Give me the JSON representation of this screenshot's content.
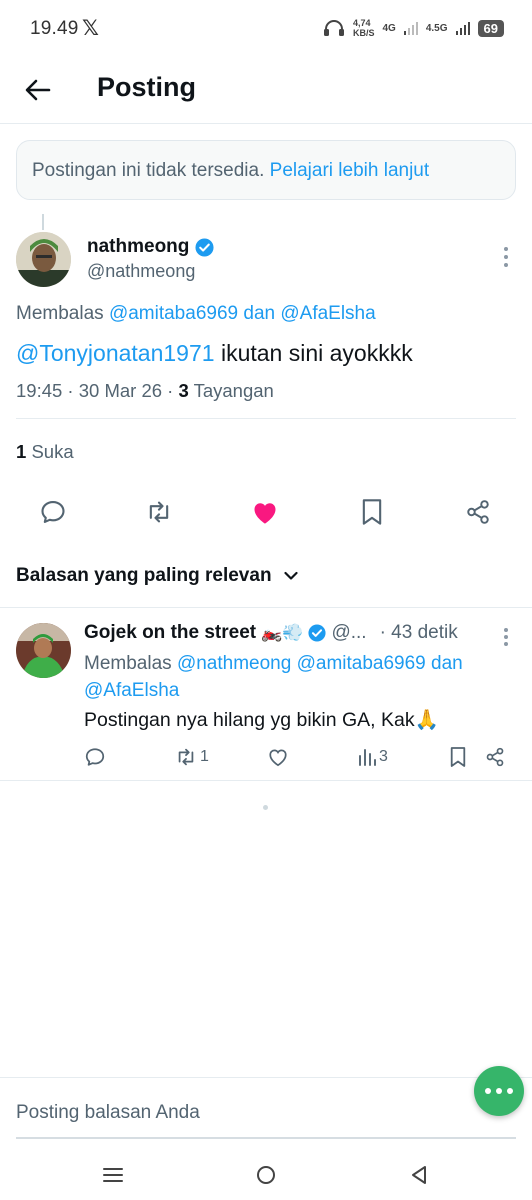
{
  "status": {
    "time": "19.49",
    "x_logo": "𝕏",
    "net_speed": "4,74",
    "net_unit": "KB/S",
    "sig1": "4G",
    "sig2": "4.5G",
    "battery": "69"
  },
  "header": {
    "title": "Posting"
  },
  "notice": {
    "text": "Postingan ini tidak tersedia.",
    "link": "Pelajari lebih lanjut"
  },
  "post": {
    "author_name": "nathmeong",
    "author_handle": "@nathmeong",
    "reply_label": "Membalas",
    "reply_mention_1": "@amitaba6969",
    "reply_and": "dan",
    "reply_mention_2": "@AfaElsha",
    "text_mention": "@Tonyjonatan1971",
    "text_body": "ikutan sini ayokkkk",
    "timestamp": "19:45 · 30 Mar 26 ·",
    "views_count": "3",
    "views_label": "Tayangan",
    "likes_count": "1",
    "likes_label": "Suka"
  },
  "actions": {
    "icons": [
      "reply-icon",
      "retweet-icon",
      "like-icon-filled",
      "bookmark-icon",
      "share-icon"
    ],
    "like_color": "#f91880"
  },
  "sort": {
    "label": "Balasan yang paling relevan"
  },
  "reply": {
    "name": "Gojek on the street",
    "emoji": "🏍️💨",
    "handle": "@...",
    "time": "· 43 detik",
    "reply_label": "Membalas",
    "mention_1": "@nathmeong",
    "mention_2": "@amitaba6969",
    "and": "dan",
    "mention_3": "@AfaElsha",
    "text": "Postingan nya hilang yg bikin GA, Kak🙏",
    "retweets": "1",
    "views": "3"
  },
  "compose": {
    "placeholder": "Posting balasan Anda"
  },
  "colors": {
    "accent": "#1d9bf0",
    "fab": "#36b56a",
    "secondary_text": "#536471"
  }
}
